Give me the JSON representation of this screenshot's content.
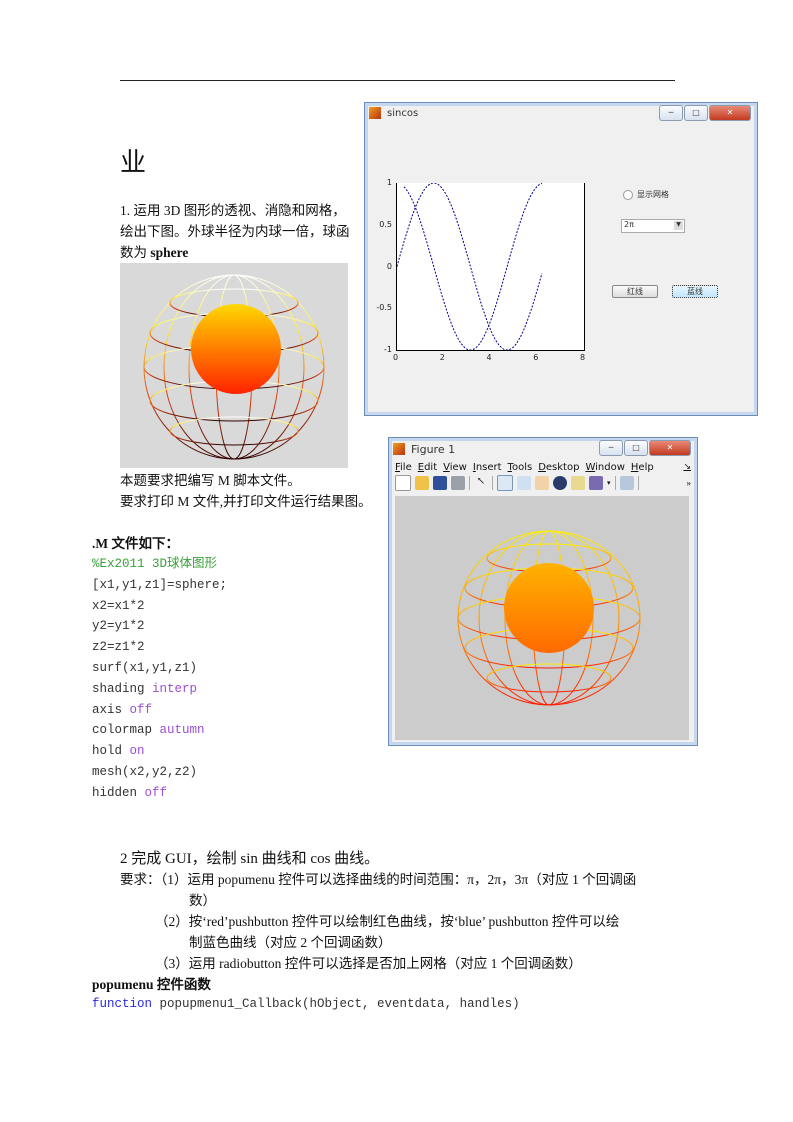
{
  "heading_fragment": "业",
  "task1": {
    "lines": [
      "1. 运用 3D 图形的透视、消隐和网格，",
      "绘出下图。外球半径为内球一倍，球函",
      "数为 "
    ],
    "bold_word": "sphere",
    "req1": "本题要求把编写 M 脚本文件。",
    "req2": "要求打印 M 文件,并打印文件运行结果图。"
  },
  "mfile_heading": ".M 文件如下：",
  "code": [
    {
      "text": "%Ex2011 3D球体图形",
      "kw": ""
    },
    {
      "text": "[x1,y1,z1]=sphere;",
      "kw": ""
    },
    {
      "text": "x2=x1*2",
      "kw": ""
    },
    {
      "text": "y2=y1*2",
      "kw": ""
    },
    {
      "text": "z2=z1*2",
      "kw": ""
    },
    {
      "text": "surf(x1,y1,z1)",
      "kw": ""
    },
    {
      "text": "shading ",
      "kw": "interp"
    },
    {
      "text": "axis ",
      "kw": "off"
    },
    {
      "text": "colormap ",
      "kw": "autumn"
    },
    {
      "text": "hold ",
      "kw": "on"
    },
    {
      "text": "mesh(x2,y2,z2)",
      "kw": ""
    },
    {
      "text": "hidden ",
      "kw": "off"
    }
  ],
  "sincos_window": {
    "title": "sincos",
    "radio_label": "显示网格",
    "popup_value": "2π",
    "red_button": "红线",
    "blue_button": "蓝线",
    "chart_data": {
      "type": "line",
      "title": "",
      "xlabel": "",
      "ylabel": "",
      "xlim": [
        0,
        8
      ],
      "ylim": [
        -1,
        1
      ],
      "xticks": [
        "0",
        "2",
        "4",
        "6",
        "8"
      ],
      "yticks": [
        "1",
        "0.5",
        "0",
        "-0.5",
        "-1"
      ],
      "series": [
        {
          "name": "sin",
          "function": "sin(x)",
          "x_range": [
            0,
            6.2
          ],
          "color": "#00008b"
        },
        {
          "name": "cos",
          "function": "cos(x)",
          "x_range": [
            0.3,
            6.2
          ],
          "color": "#00008b"
        }
      ]
    }
  },
  "figure_window": {
    "title": "Figure 1",
    "menus": [
      "File",
      "Edit",
      "View",
      "Insert",
      "Tools",
      "Desktop",
      "Window",
      "Help"
    ],
    "toolbar_icons": [
      "new-file-icon",
      "open-folder-icon",
      "save-icon",
      "print-icon",
      "pointer-icon",
      "zoom-in-icon",
      "zoom-out-icon",
      "pan-hand-icon",
      "rotate-icon",
      "data-cursor-icon",
      "brush-icon",
      "plot-tools-icon"
    ]
  },
  "task2": {
    "title": "2 完成 GUI，绘制 sin 曲线和 cos 曲线。",
    "req_label": "要求：",
    "r1a": "（1）运用 popumenu 控件可以选择曲线的时间范围：π，2π，3π（对应 1 个回调函",
    "r1b": "数）",
    "r2a": "（2）按‘red’pushbutton 控件可以绘制红色曲线，按‘blue’ pushbutton 控件可以绘",
    "r2b": "制蓝色曲线（对应 2 个回调函数）",
    "r3": "（3）运用 radiobutton 控件可以选择是否加上网格（对应 1 个回调函数）",
    "popumenu_heading": "popumenu 控件函数",
    "func_kw": "function",
    "func_sig": " popupmenu1_Callback(hObject, eventdata, handles)"
  }
}
